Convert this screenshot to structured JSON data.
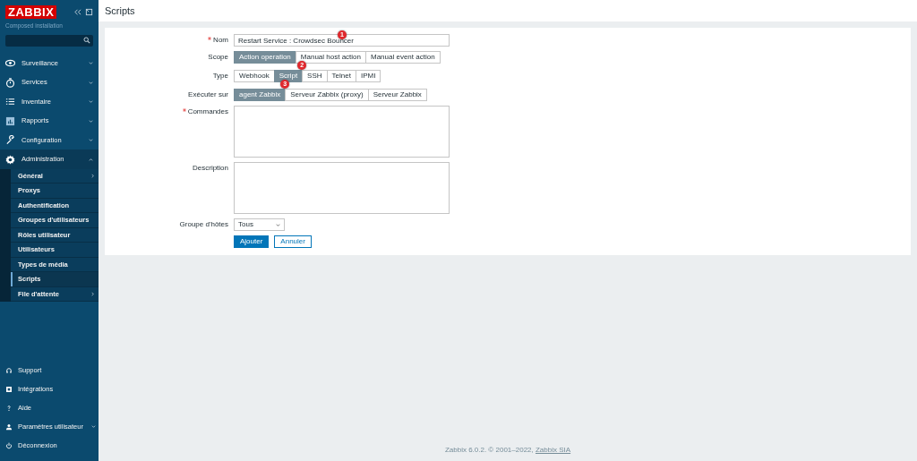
{
  "sidebar": {
    "logo": "ZABBIX",
    "subtitle": "Composed installation",
    "menu": [
      {
        "label": "Surveillance",
        "expanded": false
      },
      {
        "label": "Services",
        "expanded": false
      },
      {
        "label": "Inventaire",
        "expanded": false
      },
      {
        "label": "Rapports",
        "expanded": false
      },
      {
        "label": "Configuration",
        "expanded": false
      },
      {
        "label": "Administration",
        "expanded": true,
        "children": [
          {
            "label": "Général",
            "selected": false,
            "has_submenu": true
          },
          {
            "label": "Proxys",
            "selected": false,
            "has_submenu": false
          },
          {
            "label": "Authentification",
            "selected": false,
            "has_submenu": false
          },
          {
            "label": "Groupes d'utilisateurs",
            "selected": false,
            "has_submenu": false
          },
          {
            "label": "Rôles utilisateur",
            "selected": false,
            "has_submenu": false
          },
          {
            "label": "Utilisateurs",
            "selected": false,
            "has_submenu": false
          },
          {
            "label": "Types de média",
            "selected": false,
            "has_submenu": false
          },
          {
            "label": "Scripts",
            "selected": true,
            "has_submenu": false
          },
          {
            "label": "File d'attente",
            "selected": false,
            "has_submenu": true
          }
        ]
      }
    ],
    "bottom": [
      {
        "label": "Support",
        "has_submenu": false
      },
      {
        "label": "Intégrations",
        "has_submenu": false
      },
      {
        "label": "Aide",
        "has_submenu": false
      },
      {
        "label": "Paramètres utilisateur",
        "has_submenu": true
      },
      {
        "label": "Déconnexion",
        "has_submenu": false
      }
    ]
  },
  "page": {
    "title": "Scripts"
  },
  "form": {
    "fields": [
      {
        "kind": "text",
        "label": "Nom",
        "required": true,
        "value": "Restart Service : Crowdsec Bouncer",
        "callout": "1"
      },
      {
        "kind": "segmented",
        "label": "Scope",
        "required": false,
        "options": [
          {
            "label": "Action operation",
            "selected": true
          },
          {
            "label": "Manual host action",
            "selected": false
          },
          {
            "label": "Manual event action",
            "selected": false
          }
        ]
      },
      {
        "kind": "segmented",
        "label": "Type",
        "required": false,
        "options": [
          {
            "label": "Webhook",
            "selected": false
          },
          {
            "label": "Script",
            "selected": true,
            "callout": "2"
          },
          {
            "label": "SSH",
            "selected": false
          },
          {
            "label": "Telnet",
            "selected": false
          },
          {
            "label": "IPMI",
            "selected": false
          }
        ]
      },
      {
        "kind": "segmented",
        "label": "Exécuter sur",
        "required": false,
        "options": [
          {
            "label": "agent Zabbix",
            "selected": true,
            "callout": "3"
          },
          {
            "label": "Serveur Zabbix (proxy)",
            "selected": false
          },
          {
            "label": "Serveur Zabbix",
            "selected": false
          }
        ]
      },
      {
        "kind": "textarea",
        "label": "Commandes",
        "required": true
      },
      {
        "kind": "textarea",
        "label": "Description",
        "required": false
      },
      {
        "kind": "select",
        "label": "Groupe d'hôtes",
        "required": false,
        "value": "Tous"
      }
    ],
    "buttons": [
      {
        "label": "Ajouter",
        "kind": "primary"
      },
      {
        "label": "Annuler",
        "kind": "secondary"
      }
    ]
  },
  "footer": {
    "text": "Zabbix 6.0.2. © 2001–2022, ",
    "link": "Zabbix SIA"
  }
}
